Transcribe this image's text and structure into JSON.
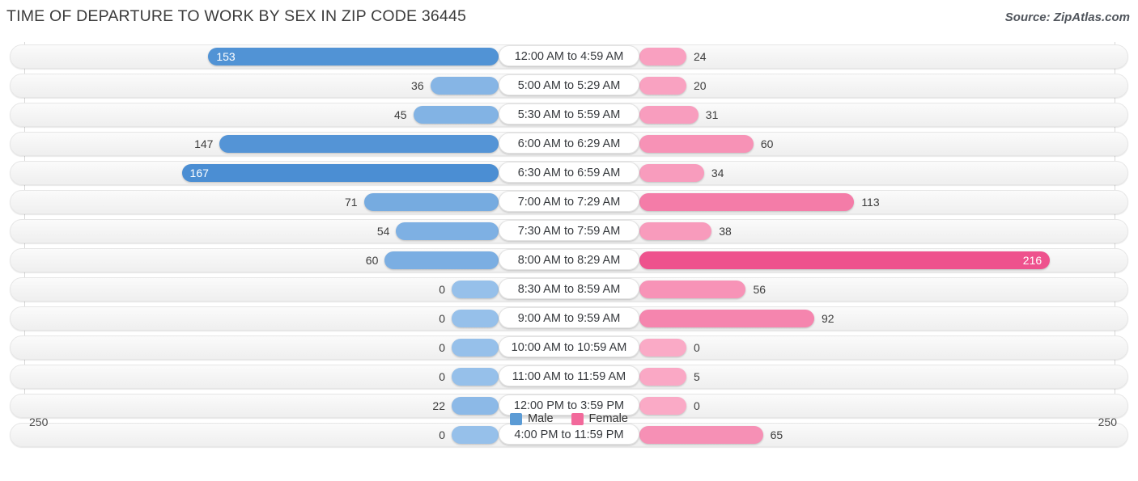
{
  "header": {
    "title": "TIME OF DEPARTURE TO WORK BY SEX IN ZIP CODE 36445",
    "source": "Source: ZipAtlas.com"
  },
  "legend": {
    "male": {
      "label": "Male",
      "color": "#5b9bd5"
    },
    "female": {
      "label": "Female",
      "color": "#f2699b"
    }
  },
  "axis": {
    "left_max": "250",
    "right_max": "250"
  },
  "chart_data": {
    "type": "bar",
    "title": "TIME OF DEPARTURE TO WORK BY SEX IN ZIP CODE 36445",
    "subtitle": "",
    "orientation": "horizontal-diverging",
    "xlabel": "",
    "ylabel": "",
    "xlim": [
      250,
      250
    ],
    "grid": true,
    "legend_position": "bottom-center",
    "categories": [
      "12:00 AM to 4:59 AM",
      "5:00 AM to 5:29 AM",
      "5:30 AM to 5:59 AM",
      "6:00 AM to 6:29 AM",
      "6:30 AM to 6:59 AM",
      "7:00 AM to 7:29 AM",
      "7:30 AM to 7:59 AM",
      "8:00 AM to 8:29 AM",
      "8:30 AM to 8:59 AM",
      "9:00 AM to 9:59 AM",
      "10:00 AM to 10:59 AM",
      "11:00 AM to 11:59 AM",
      "12:00 PM to 3:59 PM",
      "4:00 PM to 11:59 PM"
    ],
    "series": [
      {
        "name": "Male",
        "values": [
          153,
          36,
          45,
          147,
          167,
          71,
          54,
          60,
          0,
          0,
          0,
          0,
          22,
          0
        ]
      },
      {
        "name": "Female",
        "values": [
          24,
          20,
          31,
          60,
          34,
          113,
          38,
          216,
          56,
          92,
          0,
          5,
          0,
          65
        ]
      }
    ]
  },
  "rows": [
    {
      "label": "12:00 AM to 4:59 AM",
      "male": "153",
      "female": "24"
    },
    {
      "label": "5:00 AM to 5:29 AM",
      "male": "36",
      "female": "20"
    },
    {
      "label": "5:30 AM to 5:59 AM",
      "male": "45",
      "female": "31"
    },
    {
      "label": "6:00 AM to 6:29 AM",
      "male": "147",
      "female": "60"
    },
    {
      "label": "6:30 AM to 6:59 AM",
      "male": "167",
      "female": "34"
    },
    {
      "label": "7:00 AM to 7:29 AM",
      "male": "71",
      "female": "113"
    },
    {
      "label": "7:30 AM to 7:59 AM",
      "male": "54",
      "female": "38"
    },
    {
      "label": "8:00 AM to 8:29 AM",
      "male": "60",
      "female": "216"
    },
    {
      "label": "8:30 AM to 8:59 AM",
      "male": "0",
      "female": "56"
    },
    {
      "label": "9:00 AM to 9:59 AM",
      "male": "0",
      "female": "92"
    },
    {
      "label": "10:00 AM to 10:59 AM",
      "male": "0",
      "female": "0"
    },
    {
      "label": "11:00 AM to 11:59 AM",
      "male": "0",
      "female": "5"
    },
    {
      "label": "12:00 PM to 3:59 PM",
      "male": "22",
      "female": "0"
    },
    {
      "label": "4:00 PM to 11:59 PM",
      "male": "0",
      "female": "65"
    }
  ]
}
